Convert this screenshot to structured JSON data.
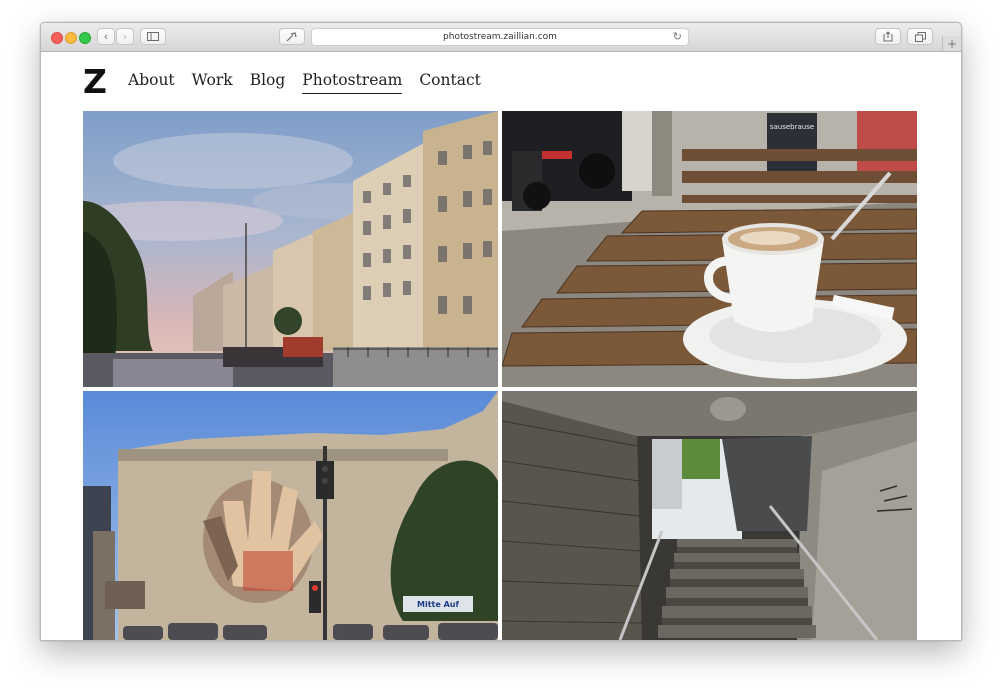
{
  "browser": {
    "url": "photostream.zaillian.com",
    "icons": {
      "back": "chevron-left-icon",
      "forward": "chevron-right-icon",
      "sidebar": "sidebar-icon",
      "reload": "reload-icon",
      "share": "share-icon",
      "tabs": "tabs-icon",
      "new_tab": "plus-icon"
    }
  },
  "site": {
    "logo": "Z",
    "nav": [
      {
        "label": "About",
        "active": false
      },
      {
        "label": "Work",
        "active": false
      },
      {
        "label": "Blog",
        "active": false
      },
      {
        "label": "Photostream",
        "active": true
      },
      {
        "label": "Contact",
        "active": false
      }
    ]
  },
  "photos": [
    {
      "subject": "canal with buildings at dusk"
    },
    {
      "subject": "coffee cup on wooden cafe table"
    },
    {
      "subject": "wall mural of hands"
    },
    {
      "subject": "stairway in tunnel"
    }
  ],
  "signage": {
    "cafe_sign_line1": "sausebrause",
    "wall_sign": "Mitte Auf"
  },
  "colors": {
    "accent": "#222222",
    "close": "#fc605c",
    "minimize": "#fdbc40",
    "maximize": "#34c84a"
  }
}
